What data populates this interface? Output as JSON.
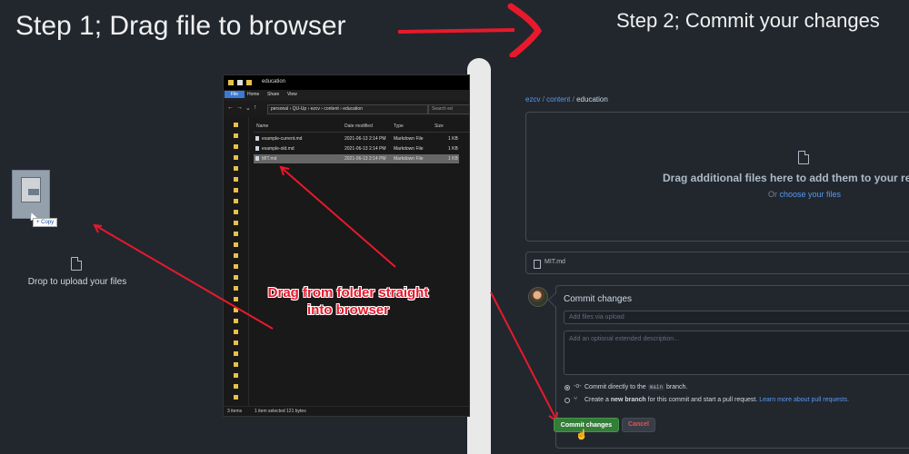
{
  "step1": {
    "title": "Step 1; Drag file to browser"
  },
  "step2": {
    "title": "Step 2; Commit your changes"
  },
  "drag_ghost": {
    "badge": "+ Copy"
  },
  "upload_zone": {
    "text": "Drop to upload your files"
  },
  "explorer": {
    "title": "education",
    "menu": [
      "File",
      "Home",
      "Share",
      "View"
    ],
    "address": "personal  ›  QU-Up  ›  ezcv  ›  content  ›  education",
    "search_placeholder": "Search ed",
    "columns": [
      "Name",
      "Date modified",
      "Type",
      "Size"
    ],
    "rows": [
      {
        "name": "example-current.md",
        "date": "2021-06-13 2:14 PM",
        "type": "Markdown File",
        "size": "1 KB"
      },
      {
        "name": "example-old.md",
        "date": "2021-06-13 2:14 PM",
        "type": "Markdown File",
        "size": "1 KB"
      },
      {
        "name": "MIT.md",
        "date": "2021-06-13 2:14 PM",
        "type": "Markdown File",
        "size": "1 KB"
      }
    ],
    "status": [
      "3 items",
      "1 item selected  121 bytes"
    ]
  },
  "annotation": {
    "line1": "Drag from folder straight",
    "line2": "into browser"
  },
  "breadcrumb": {
    "repo": "ezcv",
    "folder": "content",
    "current": "education",
    "sep": "/"
  },
  "dropzone": {
    "main": "Drag additional files here to add them to your repository",
    "or": "Or",
    "link": "choose your files"
  },
  "uploaded_file": "MIT.md",
  "commit": {
    "title": "Commit changes",
    "summary_placeholder": "Add files via upload",
    "description_placeholder": "Add an optional extended description...",
    "option1_pre": "Commit directly to the",
    "option1_branch": "main",
    "option1_post": "branch.",
    "option2_pre": "Create a",
    "option2_bold": "new branch",
    "option2_post": "for this commit and start a pull request.",
    "option2_link": "Learn more about pull requests.",
    "commit_button": "Commit changes",
    "cancel_button": "Cancel"
  },
  "colors": {
    "annotation_red": "#e8192c",
    "commit_green": "#347d39",
    "link_blue": "#539bf5",
    "background": "#22272e"
  }
}
